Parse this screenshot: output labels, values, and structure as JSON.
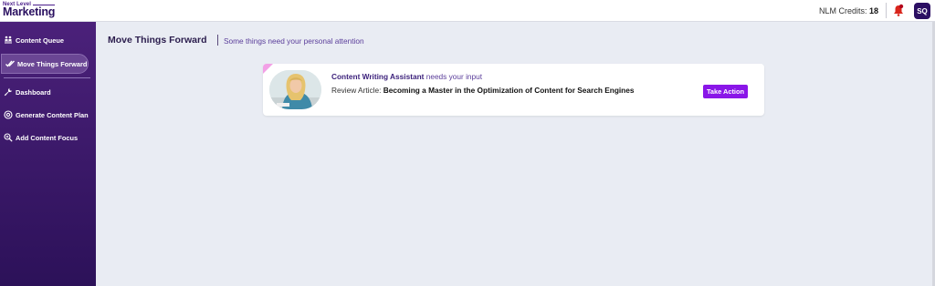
{
  "brand": {
    "top": "Next Level",
    "main": "Marketing"
  },
  "header": {
    "credits_label": "NLM Credits:",
    "credits_value": "18",
    "avatar_initials": "SQ"
  },
  "sidebar": {
    "items": [
      {
        "label": "Content Queue",
        "icon": "people-icon"
      },
      {
        "label": "Move Things Forward",
        "icon": "double-check-icon",
        "active": true
      },
      {
        "label": "Dashboard",
        "icon": "wrench-icon"
      },
      {
        "label": "Generate Content Plan",
        "icon": "at-sign-icon"
      },
      {
        "label": "Add Content Focus",
        "icon": "search-plus-icon"
      }
    ]
  },
  "main": {
    "title": "Move Things Forward",
    "subtitle": "Some things need your personal attention",
    "task": {
      "agent": "Content Writing Assistant",
      "needs": "needs your input",
      "prefix": "Review Article:",
      "article_title": "Becoming a Master in the Optimization of Content for Search Engines",
      "action_label": "Take Action"
    }
  },
  "colors": {
    "sidebar": "#3a1868",
    "accent": "#8a16e8",
    "avatar": "#2c0f63"
  }
}
